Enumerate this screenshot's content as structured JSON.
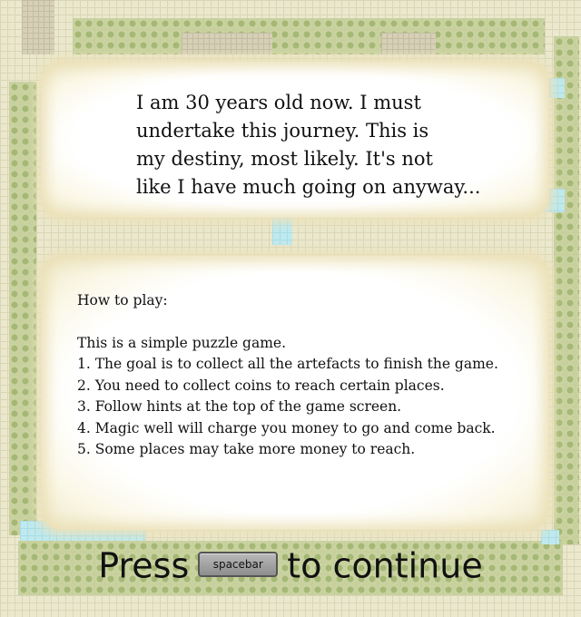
{
  "story": {
    "text": "I am 30 years old now. I must\nundertake this journey. This is\nmy destiny, most likely. It's not\nlike I have much going  on anyway..."
  },
  "instructions": {
    "heading": "How to play:",
    "lines": [
      "This is a simple puzzle game.",
      "1. The goal is to collect all the artefacts to finish the game.",
      "2. You need to collect coins to reach certain places.",
      "3. Follow hints at the top of the game screen.",
      "4. Magic well will charge you money to go and come back.",
      "5. Some places may take more money to reach."
    ]
  },
  "prompt": {
    "before": "Press",
    "key": "spacebar",
    "after": "to continue"
  },
  "colors": {
    "panel": "#ffffff",
    "panel_edge": "#eee7c6",
    "text": "#111111",
    "water": "#bfe9ee",
    "bush": "#9fb36c"
  }
}
